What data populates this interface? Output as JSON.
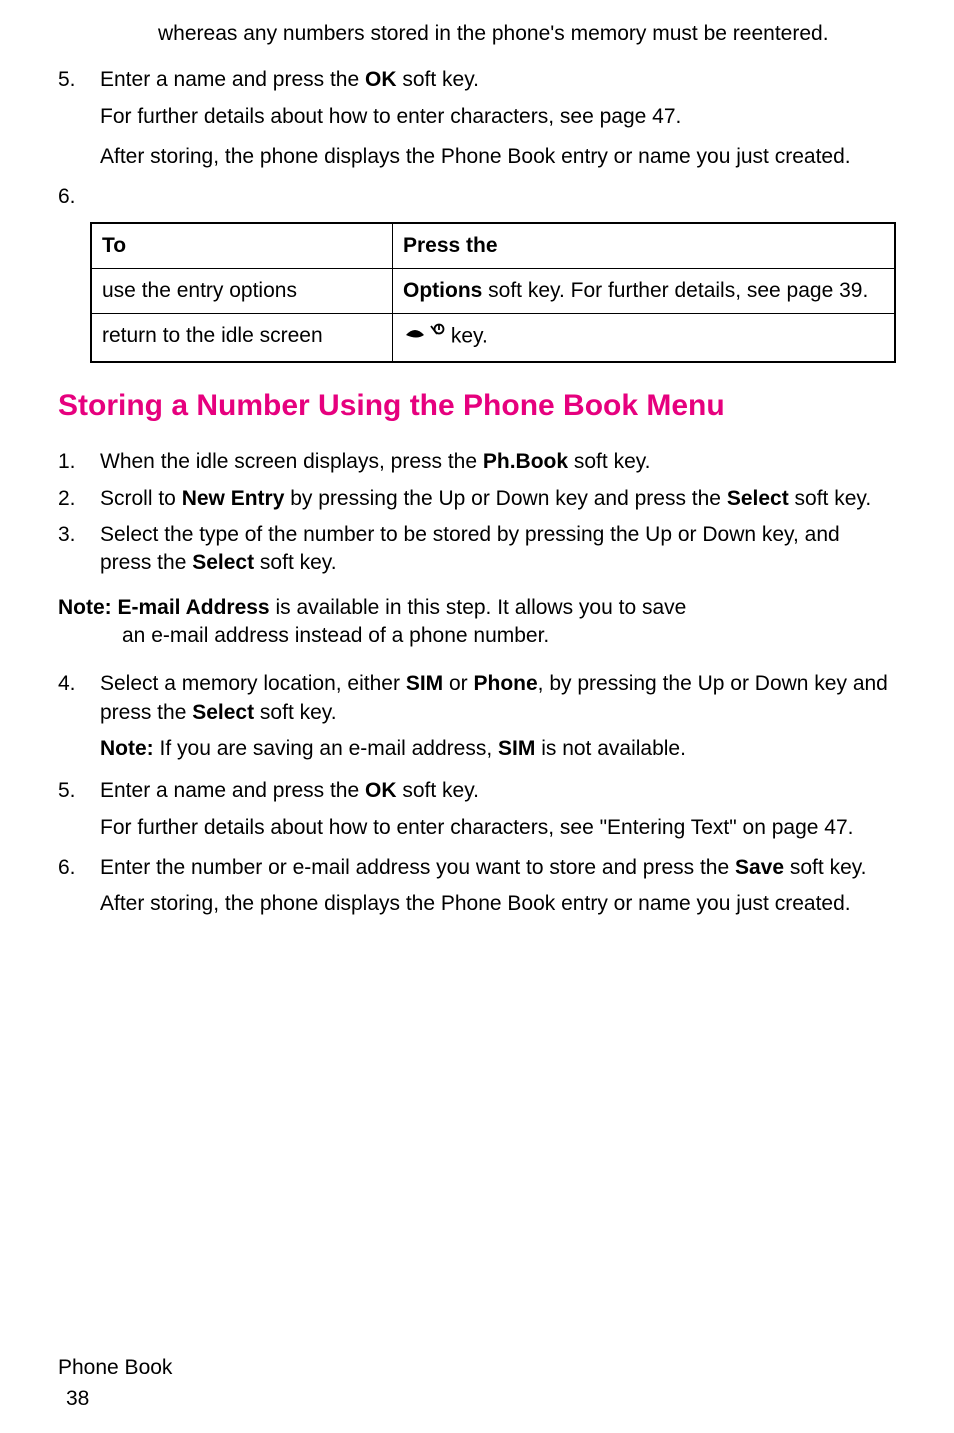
{
  "continuation": "whereas any numbers stored in the phone's memory must be reentered.",
  "step5": {
    "num": "5.",
    "text_a": "Enter a name and press the ",
    "bold_a": "OK",
    "text_b": " soft key.",
    "sub1": "For further details about how to enter characters, see page 47.",
    "sub2": "After storing, the phone displays the Phone Book entry or name you just created."
  },
  "step6_num": "6.",
  "table": {
    "header_to": "To",
    "header_press": "Press the",
    "row1_to": "use the entry options",
    "row1_press_bold": "Options",
    "row1_press_rest": " soft key. For further details, see page 39.",
    "row2_to": "return to the idle screen",
    "row2_press_rest": "  key."
  },
  "section_title": "Storing a Number Using the Phone Book Menu",
  "s1": {
    "num": "1.",
    "a": "When the idle screen displays, press the ",
    "b1": "Ph.Book",
    "c": " soft key."
  },
  "s2": {
    "num": "2.",
    "a": "Scroll to ",
    "b1": "New Entry",
    "c": " by pressing the Up or Down key and press the ",
    "b2": "Select",
    "d": " soft key."
  },
  "s3": {
    "num": "3.",
    "a": "Select the type of the number to be stored by pressing the Up or Down key, and press the ",
    "b1": "Select",
    "c": " soft key."
  },
  "note1": {
    "label": "Note: ",
    "bold": "E-mail Address",
    "rest1": " is available in this step. It allows you to save ",
    "rest2": "an e-mail address instead of a phone number."
  },
  "s4": {
    "num": "4.",
    "a": "Select a memory location, either ",
    "b1": "SIM",
    "c": " or ",
    "b2": "Phone",
    "d": ", by pressing the Up or Down key and press the ",
    "b3": "Select",
    "e": " soft key.",
    "note_label": "Note:",
    "note_a": " If you are saving an e-mail address, ",
    "note_bold": "SIM",
    "note_b": " is not available."
  },
  "s5b": {
    "num": "5.",
    "a": "Enter a name and press the ",
    "b1": "OK",
    "c": " soft key.",
    "sub": "For further details about how to enter characters, see \"Entering Text\" on page 47."
  },
  "s6b": {
    "num": "6.",
    "a": "Enter the number or e-mail address you want to store and press the ",
    "b1": "Save",
    "c": " soft key.",
    "sub": "After storing, the phone displays the Phone Book entry or name you just created."
  },
  "footer": {
    "section": "Phone Book",
    "page": "38"
  }
}
